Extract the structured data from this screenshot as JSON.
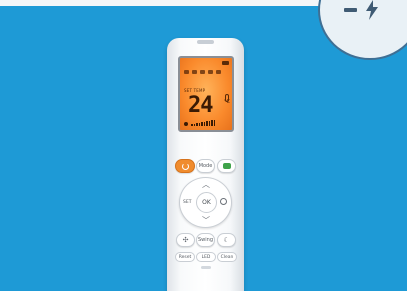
{
  "colors": {
    "background": "#1e9ad6",
    "display": "#fa8a2c",
    "power_button": "#f08c2e",
    "eco_button": "#3fa34a",
    "badge": "#e9f1f6"
  },
  "badge": {
    "icons": [
      "dash-icon",
      "lightning-bolt-icon"
    ]
  },
  "remote": {
    "display": {
      "set_label": "SET TEMP",
      "temperature": "24",
      "unit": "°C"
    },
    "buttons": {
      "power_icon": "power-icon",
      "mode_label": "Mode",
      "eco_icon": "leaf-icon",
      "ok_label": "OK",
      "set_label": "SET",
      "timer_icon": "clock-icon",
      "fan_icon": "fan-icon",
      "swing_label": "Swing",
      "sleep_icon": "sleep-icon",
      "reset_label": "Reset",
      "led_label": "LED",
      "clean_label": "Clean"
    }
  }
}
